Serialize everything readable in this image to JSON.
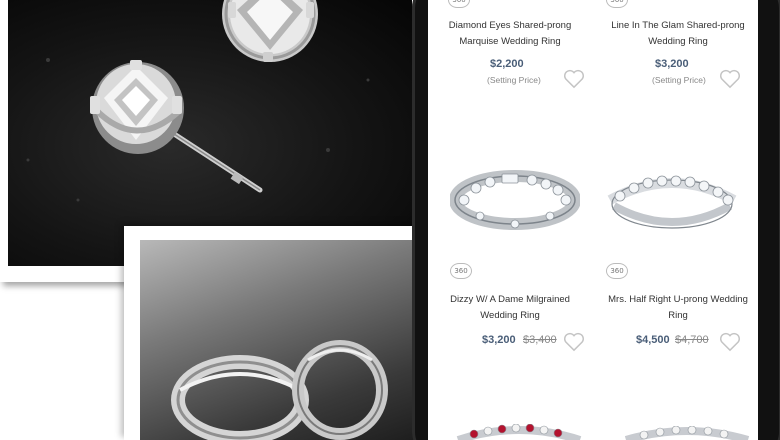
{
  "products": [
    {
      "name_line1": "Diamond Eyes Shared-prong",
      "name_line2": "Marquise Wedding Ring",
      "price": "$2,200",
      "note": "(Setting Price)",
      "badge": "360"
    },
    {
      "name_line1": "Line In The Glam Shared-prong",
      "name_line2": "Wedding Ring",
      "price": "$3,200",
      "note": "(Setting Price)",
      "badge": "360"
    },
    {
      "name_line1": "Dizzy W/ A Dame Milgrained",
      "name_line2": "Wedding Ring",
      "price": "$3,200",
      "old_price": "$3,400",
      "badge": "360"
    },
    {
      "name_line1": "Mrs. Half Right U-prong Wedding",
      "name_line2": "Ring",
      "price": "$4,500",
      "old_price": "$4,700",
      "badge": "360"
    }
  ],
  "icons": {
    "wishlist": "heart-outline-icon",
    "view360": "rotate-360-icon"
  },
  "colors": {
    "price": "#4a5e78",
    "phone_body": "#111111"
  }
}
